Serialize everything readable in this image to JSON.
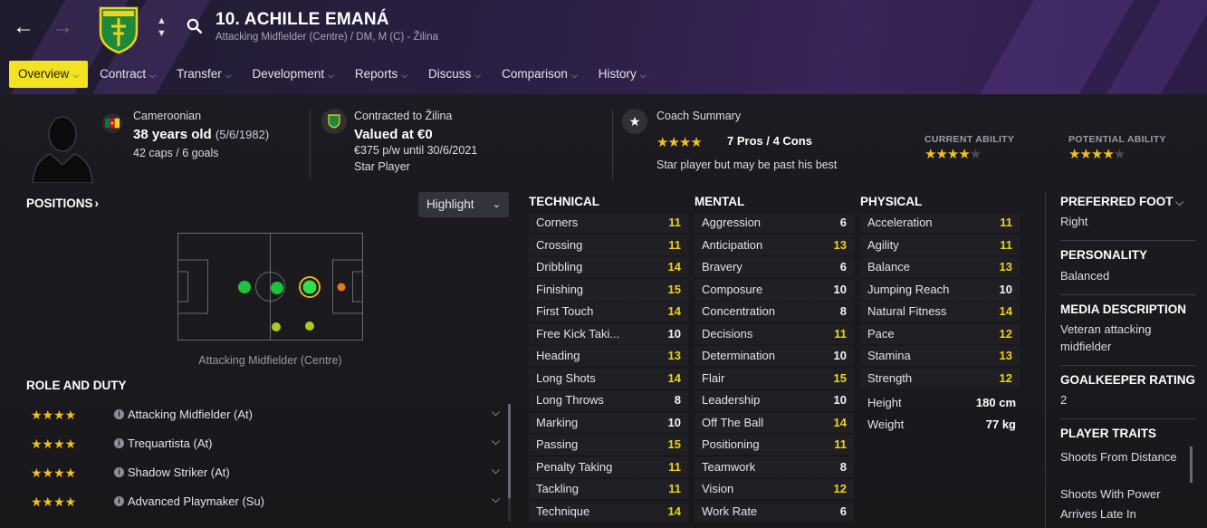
{
  "header": {
    "player_title": "10. ACHILLE EMANÁ",
    "subtitle": "Attacking Midfielder (Centre) / DM, M (C) - Žilina"
  },
  "tabs": [
    {
      "label": "Overview",
      "active": true
    },
    {
      "label": "Contract"
    },
    {
      "label": "Transfer"
    },
    {
      "label": "Development"
    },
    {
      "label": "Reports"
    },
    {
      "label": "Discuss"
    },
    {
      "label": "Comparison"
    },
    {
      "label": "History"
    }
  ],
  "info": {
    "nationality": "Cameroonian",
    "age": "38 years old",
    "dob": "(5/6/1982)",
    "caps": "42 caps / 6 goals",
    "contract_label": "Contracted to Žilina",
    "value": "Valued at €0",
    "wage": "€375 p/w until 30/6/2021",
    "status": "Star Player",
    "coach_label": "Coach Summary",
    "pros_cons": "7 Pros / 4 Cons",
    "coach_text": "Star player but may be past his best",
    "coach_stars": 4,
    "current_ability_label": "CURRENT ABILITY",
    "current_ability_stars": 4,
    "potential_ability_label": "POTENTIAL ABILITY",
    "potential_ability_stars": 4
  },
  "positions": {
    "title": "POSITIONS",
    "highlight_label": "Highlight",
    "caption": "Attacking Midfielder (Centre)"
  },
  "roles": {
    "title": "ROLE AND DUTY",
    "items": [
      {
        "name": "Attacking Midfielder (At)",
        "stars": 4
      },
      {
        "name": "Trequartista (At)",
        "stars": 4
      },
      {
        "name": "Shadow Striker (At)",
        "stars": 4
      },
      {
        "name": "Advanced Playmaker (Su)",
        "stars": 4
      }
    ]
  },
  "technical": {
    "title": "TECHNICAL",
    "items": [
      {
        "name": "Corners",
        "value": "11"
      },
      {
        "name": "Crossing",
        "value": "11"
      },
      {
        "name": "Dribbling",
        "value": "14"
      },
      {
        "name": "Finishing",
        "value": "15"
      },
      {
        "name": "First Touch",
        "value": "14"
      },
      {
        "name": "Free Kick Taki...",
        "value": "10"
      },
      {
        "name": "Heading",
        "value": "13"
      },
      {
        "name": "Long Shots",
        "value": "14"
      },
      {
        "name": "Long Throws",
        "value": "8"
      },
      {
        "name": "Marking",
        "value": "10"
      },
      {
        "name": "Passing",
        "value": "15"
      },
      {
        "name": "Penalty Taking",
        "value": "11"
      },
      {
        "name": "Tackling",
        "value": "11"
      },
      {
        "name": "Technique",
        "value": "14"
      }
    ]
  },
  "mental": {
    "title": "MENTAL",
    "items": [
      {
        "name": "Aggression",
        "value": "6"
      },
      {
        "name": "Anticipation",
        "value": "13"
      },
      {
        "name": "Bravery",
        "value": "6"
      },
      {
        "name": "Composure",
        "value": "10"
      },
      {
        "name": "Concentration",
        "value": "8"
      },
      {
        "name": "Decisions",
        "value": "11"
      },
      {
        "name": "Determination",
        "value": "10"
      },
      {
        "name": "Flair",
        "value": "15"
      },
      {
        "name": "Leadership",
        "value": "10"
      },
      {
        "name": "Off The Ball",
        "value": "14"
      },
      {
        "name": "Positioning",
        "value": "11"
      },
      {
        "name": "Teamwork",
        "value": "8"
      },
      {
        "name": "Vision",
        "value": "12"
      },
      {
        "name": "Work Rate",
        "value": "6"
      }
    ]
  },
  "physical": {
    "title": "PHYSICAL",
    "items": [
      {
        "name": "Acceleration",
        "value": "11"
      },
      {
        "name": "Agility",
        "value": "11"
      },
      {
        "name": "Balance",
        "value": "13"
      },
      {
        "name": "Jumping Reach",
        "value": "10"
      },
      {
        "name": "Natural Fitness",
        "value": "14"
      },
      {
        "name": "Pace",
        "value": "12"
      },
      {
        "name": "Stamina",
        "value": "13"
      },
      {
        "name": "Strength",
        "value": "12"
      }
    ],
    "height_label": "Height",
    "height": "180 cm",
    "weight_label": "Weight",
    "weight": "77 kg"
  },
  "side": {
    "preferred_foot_title": "PREFERRED FOOT",
    "preferred_foot": "Right",
    "personality_title": "PERSONALITY",
    "personality": "Balanced",
    "media_title": "MEDIA DESCRIPTION",
    "media_line1": "Veteran attacking",
    "media_line2": "midfielder",
    "gk_title": "GOALKEEPER RATING",
    "gk_value": "2",
    "traits_title": "PLAYER TRAITS",
    "traits": [
      "Shoots From Distance",
      "Shoots With Power",
      "Arrives Late In"
    ]
  },
  "colors": {
    "accent_yellow": "#f3e221",
    "star": "#f1c21b",
    "attr_high": "#f1d21e"
  }
}
